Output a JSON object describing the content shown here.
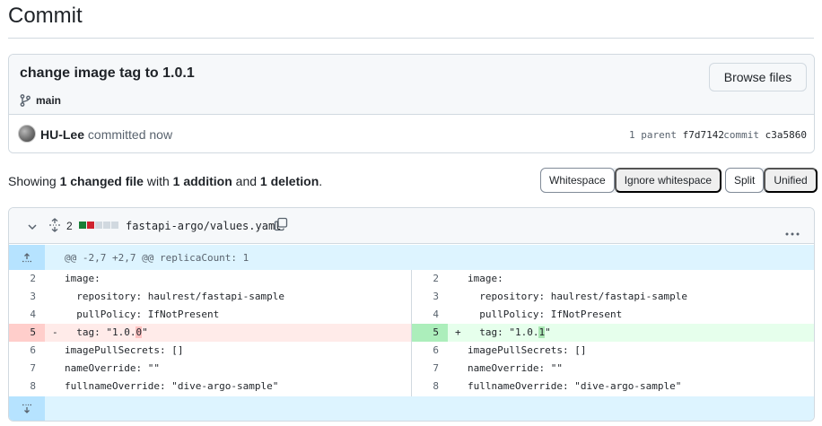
{
  "page": {
    "title": "Commit"
  },
  "commit": {
    "message": "change image tag to 1.0.1",
    "branch": "main",
    "browse_label": "Browse files",
    "author": "HU-Lee",
    "action": "committed now",
    "parent_count_label": "1 parent",
    "parent_sha": "f7d7142",
    "commit_label": "commit",
    "commit_sha": "c3a5860"
  },
  "summary": {
    "prefix": "Showing",
    "files": "1 changed file",
    "with": "with",
    "additions": "1 addition",
    "and": "and",
    "deletions": "1 deletion",
    "suffix": "."
  },
  "toolbar": {
    "whitespace": "Whitespace",
    "ignore_whitespace": "Ignore whitespace",
    "split": "Split",
    "unified": "Unified"
  },
  "file": {
    "change_count": "2",
    "path": "fastapi-argo/values.yaml",
    "hunk_header": "@@ -2,7 +2,7 @@ replicaCount: 1",
    "diffstat_colors": [
      "#1a7f37",
      "#cf222e",
      "#d1d9e0",
      "#d1d9e0",
      "#d1d9e0"
    ]
  },
  "diff": {
    "left": [
      {
        "num": "2",
        "marker": "",
        "code": "image:",
        "type": "ctx"
      },
      {
        "num": "3",
        "marker": "",
        "code": "  repository: haulrest/fastapi-sample",
        "type": "ctx"
      },
      {
        "num": "4",
        "marker": "",
        "code": "  pullPolicy: IfNotPresent",
        "type": "ctx"
      },
      {
        "num": "5",
        "marker": "-",
        "code_pre": "  tag: \"1.0.",
        "code_hl": "0",
        "code_post": "\"",
        "type": "del"
      },
      {
        "num": "6",
        "marker": "",
        "code": "imagePullSecrets: []",
        "type": "ctx"
      },
      {
        "num": "7",
        "marker": "",
        "code": "nameOverride: \"\"",
        "type": "ctx"
      },
      {
        "num": "8",
        "marker": "",
        "code": "fullnameOverride: \"dive-argo-sample\"",
        "type": "ctx"
      }
    ],
    "right": [
      {
        "num": "2",
        "marker": "",
        "code": "image:",
        "type": "ctx"
      },
      {
        "num": "3",
        "marker": "",
        "code": "  repository: haulrest/fastapi-sample",
        "type": "ctx"
      },
      {
        "num": "4",
        "marker": "",
        "code": "  pullPolicy: IfNotPresent",
        "type": "ctx"
      },
      {
        "num": "5",
        "marker": "+",
        "code_pre": "  tag: \"1.0.",
        "code_hl": "1",
        "code_post": "\"",
        "type": "add"
      },
      {
        "num": "6",
        "marker": "",
        "code": "imagePullSecrets: []",
        "type": "ctx"
      },
      {
        "num": "7",
        "marker": "",
        "code": "nameOverride: \"\"",
        "type": "ctx"
      },
      {
        "num": "8",
        "marker": "",
        "code": "fullnameOverride: \"dive-argo-sample\"",
        "type": "ctx"
      }
    ]
  }
}
